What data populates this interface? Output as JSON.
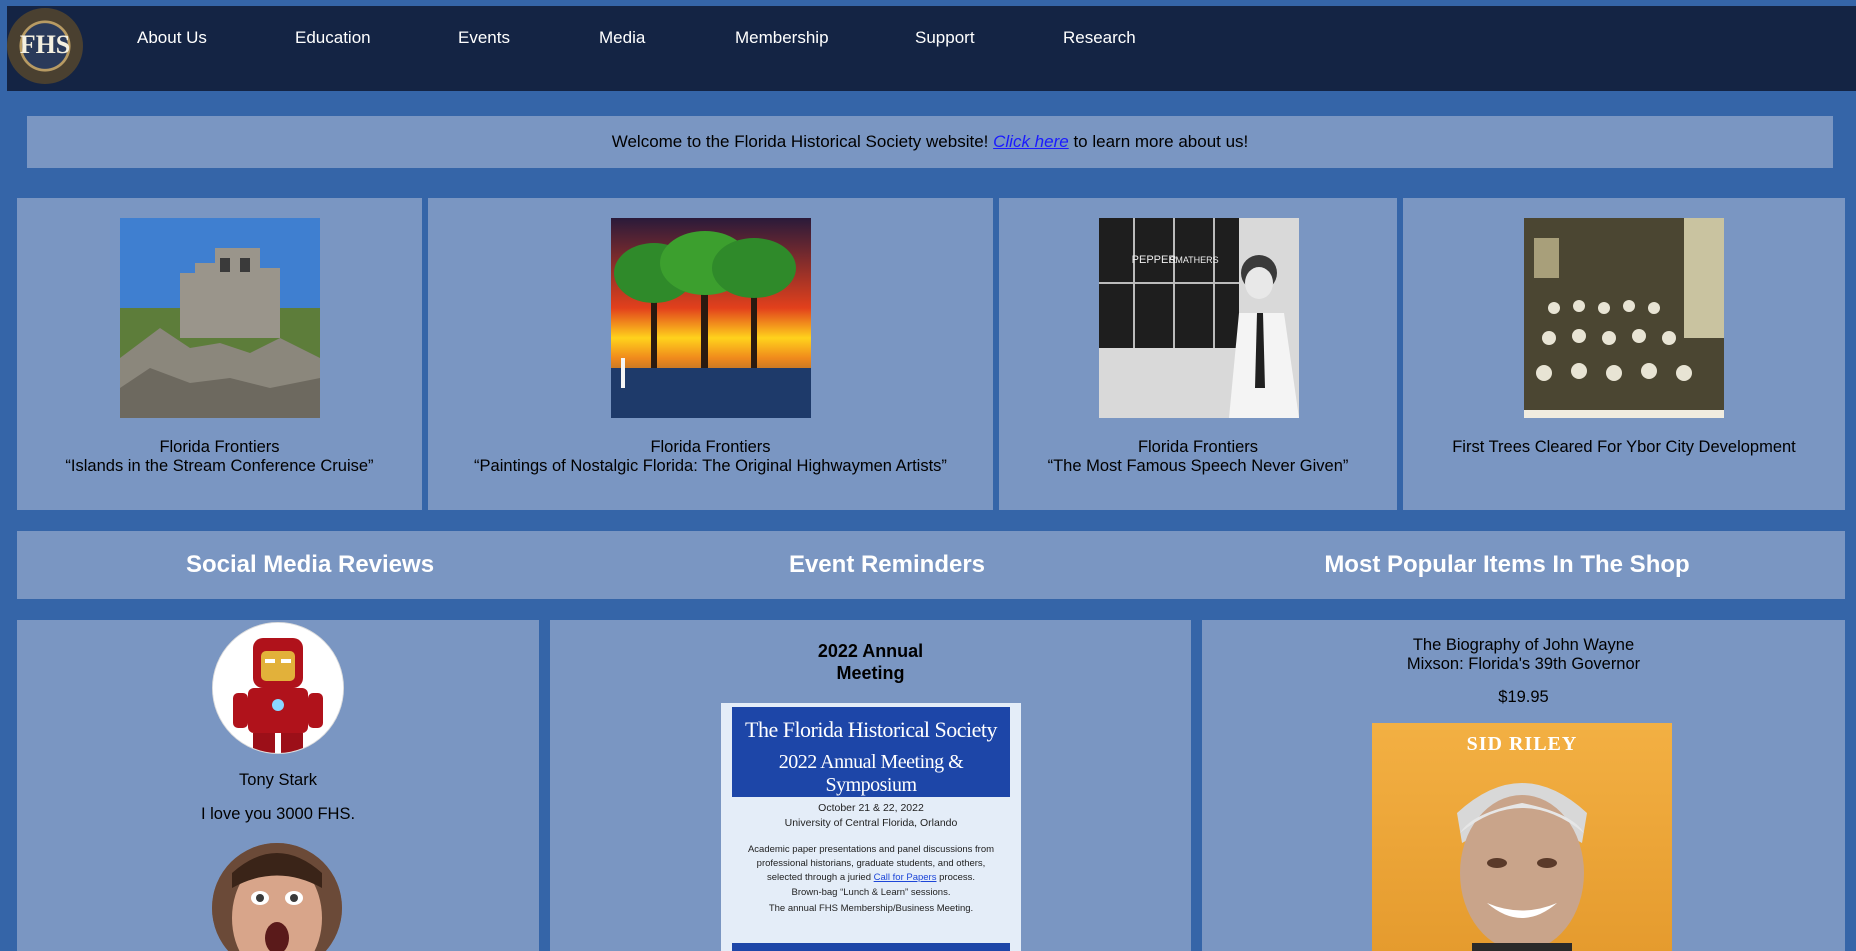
{
  "nav": {
    "logo_text": "FHS",
    "items": [
      "About Us",
      "Education",
      "Events",
      "Media",
      "Membership",
      "Support",
      "Research"
    ]
  },
  "welcome": {
    "before": "Welcome to the Florida Historical Society website!",
    "link": "Click here",
    "after": "to learn more about us!"
  },
  "features": [
    {
      "line1": "Florida Frontiers",
      "line2": "“Islands in the Stream Conference Cruise”"
    },
    {
      "line1": "Florida Frontiers",
      "line2": "“Paintings of Nostalgic Florida: The Original Highwaymen Artists”"
    },
    {
      "line1": "Florida Frontiers",
      "line2": "“The Most Famous Speech Never Given”"
    },
    {
      "line1": "First Trees Cleared For Ybor City Development",
      "line2": ""
    }
  ],
  "board_text": {
    "pepper": "PEPPER",
    "smathers": "SMATHERS"
  },
  "sections": {
    "social": "Social Media Reviews",
    "events": "Event Reminders",
    "shop": "Most Popular Items In The Shop"
  },
  "reviews": [
    {
      "name": "Tony Stark",
      "text": "I love you 3000 FHS."
    }
  ],
  "event": {
    "title_line1": "2022 Annual",
    "title_line2": "Meeting",
    "poster": {
      "header1": "The Florida Historical Society",
      "header2": "2022 Annual Meeting & Symposium",
      "dates": "October 21 & 22, 2022",
      "venue": "University of Central Florida, Orlando",
      "desc1": "Academic paper presentations and panel discussions from",
      "desc2": "professional historians, graduate students, and others,",
      "desc3_before": "selected through a juried",
      "desc3_link": "Call for Papers",
      "desc3_after": "process.",
      "desc4": "Brown-bag “Lunch & Learn” sessions.",
      "desc5": "The annual FHS Membership/Business Meeting."
    }
  },
  "shop": {
    "title_line1": "The Biography of John Wayne",
    "title_line2": "Mixson: Florida's 39th Governor",
    "price": "$19.95",
    "cover_author": "SID RILEY"
  }
}
